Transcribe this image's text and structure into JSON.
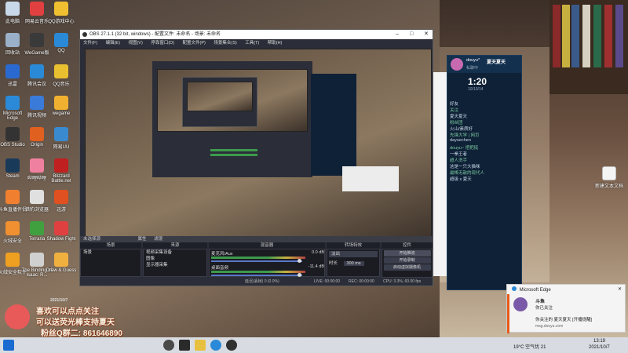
{
  "desktop": {
    "icons": [
      {
        "label": "此电脑"
      },
      {
        "label": "网易云音乐"
      },
      {
        "label": "QQ游戏中心"
      },
      {
        "label": "回收站"
      },
      {
        "label": "WeGame版"
      },
      {
        "label": "QQ"
      },
      {
        "label": "迅雷"
      },
      {
        "label": "腾讯会议"
      },
      {
        "label": "QQ音乐"
      },
      {
        "label": "Microsoft Edge"
      },
      {
        "label": "腾讯视频"
      },
      {
        "label": "wegame"
      },
      {
        "label": "OBS Studio"
      },
      {
        "label": "Origin"
      },
      {
        "label": "网易UU"
      },
      {
        "label": "Steam"
      },
      {
        "label": "哔哩哔哩"
      },
      {
        "label": "Blizzard Battle.net"
      },
      {
        "label": "斗鱼直播伴侣"
      },
      {
        "label": "猎豹浏览器"
      },
      {
        "label": "迅游"
      },
      {
        "label": "火绒安全"
      },
      {
        "label": "Terraria"
      },
      {
        "label": "Shadow Fight"
      },
      {
        "label": "火绒安全软件"
      },
      {
        "label": "The Binding of Isaac: R..."
      },
      {
        "label": "Draw & Guess"
      }
    ],
    "right_file_label": "新建文本文档"
  },
  "obs": {
    "title": "OBS 27.1.1 (32 bit, windows) - 配置文件: 未命名 - 场景: 未命名",
    "menu": [
      "文件(F)",
      "编辑(E)",
      "视图(V)",
      "停靠窗口(D)",
      "配置文件(P)",
      "场景集合(S)",
      "工具(T)",
      "帮助(H)"
    ],
    "not_selected": "未选择源",
    "dock_props": "属性",
    "dock_filters": "滤镜",
    "docks": {
      "scenes": {
        "title": "场景",
        "items": [
          "场景"
        ]
      },
      "sources": {
        "title": "来源",
        "items": [
          "视频采集设备",
          "图像",
          "显示器采集"
        ]
      },
      "mixer": {
        "title": "混音器",
        "channels": [
          {
            "name": "桌面音频",
            "level": "-11.4 dB"
          },
          {
            "name": "麦克风/Aux",
            "level": "0.0 dB"
          }
        ]
      },
      "transitions": {
        "title": "转场特效",
        "type": "淡出",
        "duration_label": "时长",
        "duration": "300 ms"
      },
      "controls": {
        "title": "控件",
        "buttons": [
          "开始推流",
          "开始录制",
          "启动虚拟摄像机",
          "工作室模式",
          "设置",
          "退出"
        ]
      }
    },
    "status": {
      "live": "LIVE: 00:00:00",
      "rec": "REC: 00:00:00",
      "cpu": "CPU: 3.3%, 60.00 fps",
      "dropped": "延迟(丢帧) 0 (0.0%)"
    }
  },
  "douyu": {
    "user": "douyu*",
    "name": "夏天夏天",
    "sub": "私聊中",
    "timer": "1:20",
    "date": "10/10/14",
    "lines": [
      "好友",
      "关注",
      "夏天夏天",
      "粉丝团",
      "火山/素质好",
      "先锋大学 | 网页",
      "dayuechen",
      "douyu~ 把把挺",
      "一拳王者",
      "超人洗手",
      "这是一只大猫咪",
      "最棒无敌的现代人",
      "超级 x 夏天"
    ]
  },
  "notification": {
    "app": "Microsoft Edge",
    "title": "斗鱼",
    "line1": "你已关注",
    "line2": "你关注的 夏天夏天 [开播提醒]",
    "source": "msg.douyu.com"
  },
  "overlay": {
    "line1": "喜欢可以点点关注",
    "line2": "可以送荧光棒支持夏天",
    "line3": "粉丝Q群二: 861646890",
    "stamp": "2021/10/7"
  },
  "taskbar": {
    "weather": "19°C 空气优 21",
    "time": "13:19",
    "date": "2021/10/7"
  }
}
